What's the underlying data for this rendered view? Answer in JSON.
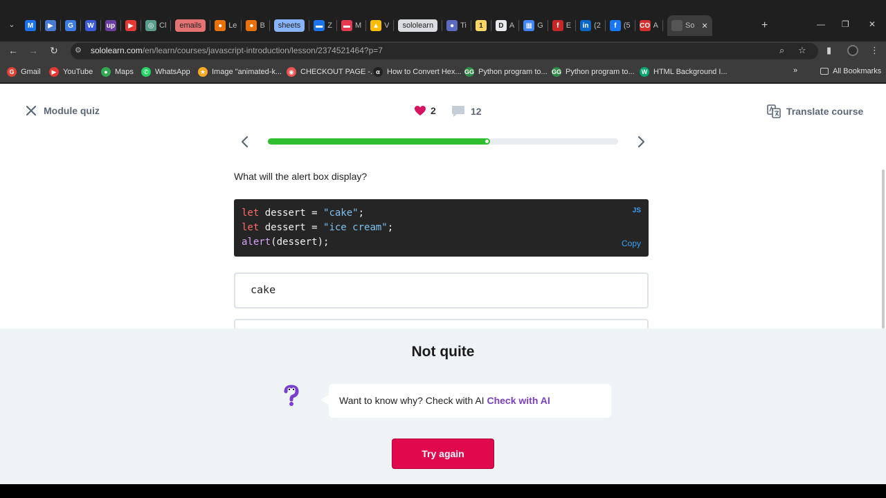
{
  "browser": {
    "tabs": [
      {
        "label": "",
        "icon": "gmail-m-icon",
        "color": "#1a73e8",
        "glyph": "M"
      },
      {
        "label": "",
        "icon": "play-icon",
        "color": "#4a7bd4",
        "glyph": "▶"
      },
      {
        "label": "",
        "icon": "google-icon",
        "color": "#3c7be0",
        "glyph": "G"
      },
      {
        "label": "",
        "icon": "wix-icon",
        "color": "#3b5bdb",
        "glyph": "W"
      },
      {
        "label": "",
        "icon": "upwork-icon",
        "color": "#6b3fa0",
        "glyph": "up"
      },
      {
        "label": "",
        "icon": "youtube-icon",
        "color": "#e53935",
        "glyph": "▶"
      },
      {
        "label": "Cl",
        "icon": "chatgpt-icon",
        "color": "#5a9c8a",
        "glyph": "◎"
      },
      {
        "label": "emails",
        "icon": "",
        "color": "#e57373",
        "pill": true
      },
      {
        "label": "Le",
        "icon": "maps-pin-icon",
        "color": "#e8710a",
        "glyph": "●"
      },
      {
        "label": "B",
        "icon": "maps-pin-icon",
        "color": "#e8710a",
        "glyph": "●"
      },
      {
        "label": "sheets",
        "icon": "",
        "color": "#8ab4f8",
        "pill": true
      },
      {
        "label": "Z",
        "icon": "doc-icon",
        "color": "#1a73e8",
        "glyph": "▬"
      },
      {
        "label": "M",
        "icon": "mail-icon",
        "color": "#e53950",
        "glyph": "▬"
      },
      {
        "label": "V",
        "icon": "drive-icon",
        "color": "#fbbc04",
        "glyph": "▲"
      },
      {
        "label": "sololearn",
        "icon": "",
        "color": "#dadce0",
        "pill": true
      },
      {
        "label": "Ti",
        "icon": "globe-icon",
        "color": "#5c6bc0",
        "glyph": "●"
      },
      {
        "label": "",
        "icon": "one-badge-icon",
        "color": "#fdd663",
        "glyph": "1"
      },
      {
        "label": "A",
        "icon": "d-icon",
        "color": "#e8eaed",
        "glyph": "D"
      },
      {
        "label": "G",
        "icon": "google-doc-icon",
        "color": "#4285f4",
        "glyph": "▦"
      },
      {
        "label": "E",
        "icon": "e-icon",
        "color": "#c62828",
        "glyph": "f"
      },
      {
        "label": "(2",
        "icon": "linkedin-icon",
        "color": "#0a66c2",
        "glyph": "in"
      },
      {
        "label": "(5",
        "icon": "facebook-icon",
        "color": "#1877f2",
        "glyph": "f"
      },
      {
        "label": "A",
        "icon": "cc-icon",
        "color": "#d32f2f",
        "glyph": "CO"
      },
      {
        "label": "So",
        "icon": "sololearn-icon",
        "color": "#555",
        "glyph": "",
        "active": true
      }
    ],
    "url_host": "sololearn.com",
    "url_path": "/en/learn/courses/javascript-introduction/lesson/2374521464?p=7",
    "bookmarks": [
      {
        "label": "Gmail",
        "icon": "google-icon",
        "color": "#db4437",
        "glyph": "G"
      },
      {
        "label": "YouTube",
        "icon": "youtube-icon",
        "color": "#e53935",
        "glyph": "▶"
      },
      {
        "label": "Maps",
        "icon": "maps-pin-icon",
        "color": "#34a853",
        "glyph": "●"
      },
      {
        "label": "WhatsApp",
        "icon": "whatsapp-icon",
        "color": "#25d366",
        "glyph": "✆"
      },
      {
        "label": "Image \"animated-k...",
        "icon": "star-icon",
        "color": "#f9a825",
        "glyph": "★"
      },
      {
        "label": "CHECKOUT PAGE -...",
        "icon": "checkout-icon",
        "color": "#ef5350",
        "glyph": "◉"
      },
      {
        "label": "How to Convert Hex...",
        "icon": "alpha-icon",
        "color": "#222",
        "glyph": "α"
      },
      {
        "label": "Python program to...",
        "icon": "gfg-icon",
        "color": "#2f8d46",
        "glyph": "GG"
      },
      {
        "label": "Python program to...",
        "icon": "gfg-icon",
        "color": "#2f8d46",
        "glyph": "GG"
      },
      {
        "label": "HTML Background I...",
        "icon": "w3-icon",
        "color": "#04aa6d",
        "glyph": "W"
      }
    ],
    "all_bookmarks": "All Bookmarks"
  },
  "lesson": {
    "module_quiz": "Module quiz",
    "likes": "2",
    "comments": "12",
    "translate": "Translate course",
    "progress": 0.63,
    "question": "What will the alert box display?",
    "code": {
      "lang": "JS",
      "copy": "Copy",
      "lines": [
        {
          "kw": "let",
          "name": " dessert = ",
          "str": "\"cake\"",
          "end": ";"
        },
        {
          "kw": "let",
          "name": " dessert = ",
          "str": "\"ice cream\"",
          "end": ";"
        }
      ],
      "line3_fn": "alert",
      "line3_rest": "(dessert);"
    },
    "answer": "cake"
  },
  "feedback": {
    "title": "Not quite",
    "prompt": "Want to know why? Check with AI ",
    "ai_link": "Check with AI",
    "try_again": "Try again"
  },
  "colors": {
    "progress": "#2ebd2e",
    "accent": "#e0094e",
    "ai_link": "#7a3ec4"
  }
}
